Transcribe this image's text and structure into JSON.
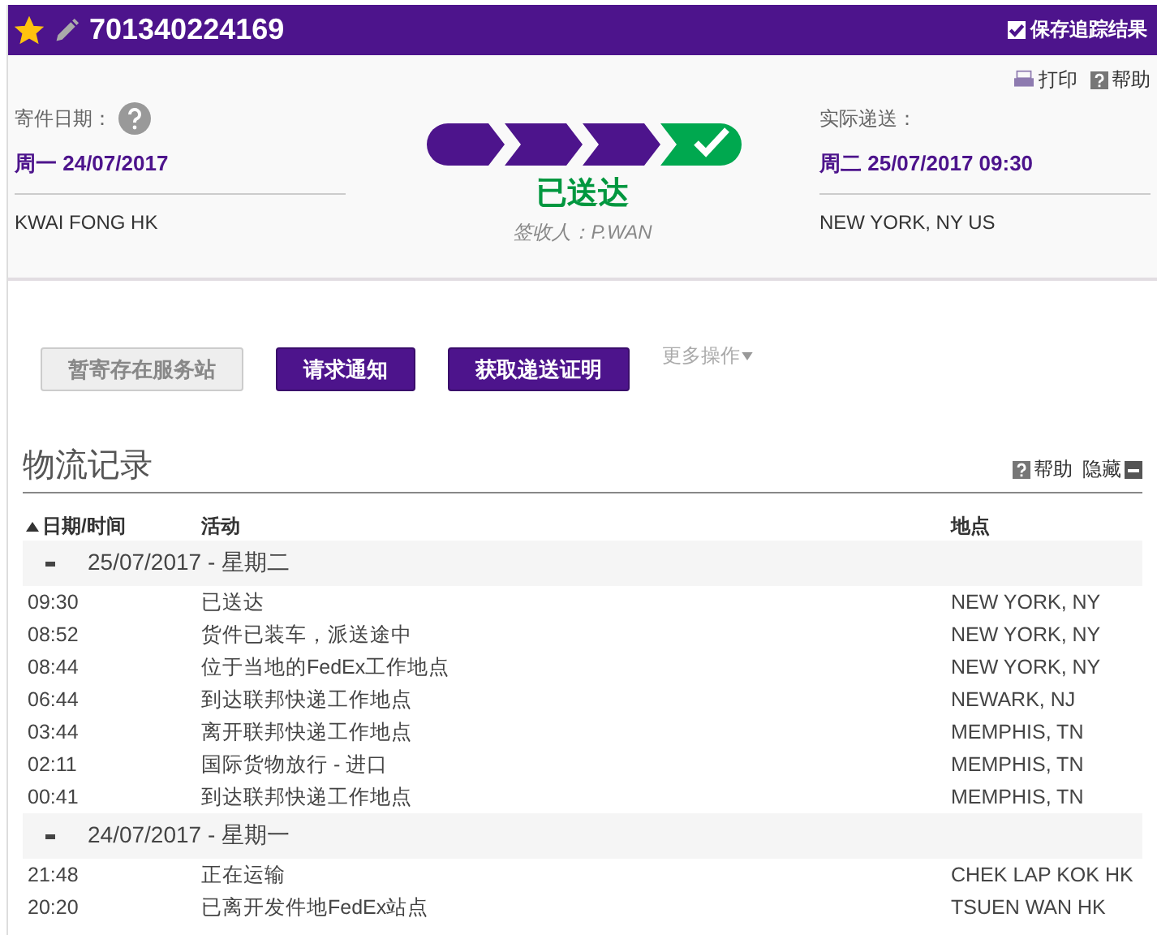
{
  "header": {
    "starred": true,
    "tracking_number": "701340224169",
    "save_results": {
      "label": "保存追踪结果",
      "checked": true
    }
  },
  "tools": [
    {
      "kind": "print",
      "label": "打印"
    },
    {
      "kind": "help",
      "label": "帮助"
    }
  ],
  "ship_info": {
    "label": "寄件日期：",
    "date": "周一 24/07/2017",
    "location": "KWAI FONG HK"
  },
  "status": {
    "steps": [
      {
        "kind": "passed"
      },
      {
        "kind": "passed"
      },
      {
        "kind": "passed"
      },
      {
        "kind": "delivered"
      }
    ],
    "label": "已送达",
    "signed_by": "签收人：P.WAN"
  },
  "delivery_info": {
    "label": "实际递送：",
    "date": "周二 25/07/2017 09:30",
    "location": "NEW YORK, NY US"
  },
  "actions": [
    {
      "label": "暂寄存在服务站",
      "disabled": true
    },
    {
      "label": "请求通知",
      "disabled": false
    },
    {
      "label": "获取递送证明",
      "disabled": false
    }
  ],
  "more_actions": "更多操作",
  "history": {
    "title": "物流记录",
    "help": "帮助",
    "hide": "隐藏",
    "columns": [
      {
        "label": "日期/时间",
        "sorted": true
      },
      {
        "label": "活动",
        "sorted": false
      },
      {
        "label": "地点",
        "sorted": false
      }
    ],
    "groups": [
      {
        "date": "25/07/2017 - 星期二",
        "expanded": true,
        "rows": [
          {
            "time": "09:30",
            "activity": "已送达",
            "location": "NEW YORK, NY"
          },
          {
            "time": "08:52",
            "activity": "货件已装车，派送途中",
            "location": "NEW YORK, NY"
          },
          {
            "time": "08:44",
            "activity": "位于当地的FedEx工作地点",
            "location": "NEW YORK, NY"
          },
          {
            "time": "06:44",
            "activity": "到达联邦快递工作地点",
            "location": "NEWARK, NJ"
          },
          {
            "time": "03:44",
            "activity": "离开联邦快递工作地点",
            "location": "MEMPHIS, TN"
          },
          {
            "time": "02:11",
            "activity": "国际货物放行 - 进口",
            "location": "MEMPHIS, TN"
          },
          {
            "time": "00:41",
            "activity": "到达联邦快递工作地点",
            "location": "MEMPHIS, TN"
          }
        ]
      },
      {
        "date": "24/07/2017 - 星期一",
        "expanded": true,
        "rows": [
          {
            "time": "21:48",
            "activity": "正在运输",
            "location": "CHEK LAP KOK HK"
          },
          {
            "time": "20:20",
            "activity": "已离开发件地FedEx站点",
            "location": "TSUEN WAN HK"
          }
        ]
      }
    ]
  }
}
